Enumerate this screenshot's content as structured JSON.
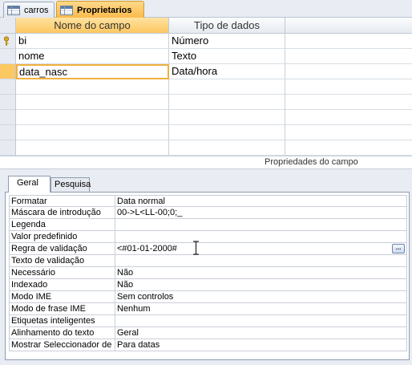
{
  "tabs": [
    {
      "label": "carros",
      "icon": "table-icon",
      "active": false
    },
    {
      "label": "Proprietarios",
      "icon": "table-icon",
      "active": true
    }
  ],
  "grid": {
    "headers": {
      "name": "Nome do campo",
      "type": "Tipo de dados"
    },
    "rows": [
      {
        "name": "bi",
        "type": "Número",
        "key": true
      },
      {
        "name": "nome",
        "type": "Texto",
        "key": false
      },
      {
        "name": "data_nasc",
        "type": "Data/hora",
        "key": false,
        "current": true
      }
    ]
  },
  "properties": {
    "title": "Propriedades do campo",
    "tabs": [
      "Geral",
      "Pesquisa"
    ],
    "rows": [
      {
        "label": "Formatar",
        "value": "Data normal"
      },
      {
        "label": "Máscara de introdução",
        "value": "00->L<LL-00;0;_"
      },
      {
        "label": "Legenda",
        "value": ""
      },
      {
        "label": "Valor predefinido",
        "value": ""
      },
      {
        "label": "Regra de validação",
        "value": "<#01-01-2000#",
        "builder": true
      },
      {
        "label": "Texto de validação",
        "value": ""
      },
      {
        "label": "Necessário",
        "value": "Não"
      },
      {
        "label": "Indexado",
        "value": "Não"
      },
      {
        "label": "Modo IME",
        "value": "Sem controlos"
      },
      {
        "label": "Modo de frase IME",
        "value": "Nenhum"
      },
      {
        "label": "Etiquetas inteligentes",
        "value": ""
      },
      {
        "label": "Alinhamento do texto",
        "value": "Geral"
      },
      {
        "label": "Mostrar Seleccionador de",
        "value": "Para datas"
      }
    ],
    "builder_label": "..."
  }
}
